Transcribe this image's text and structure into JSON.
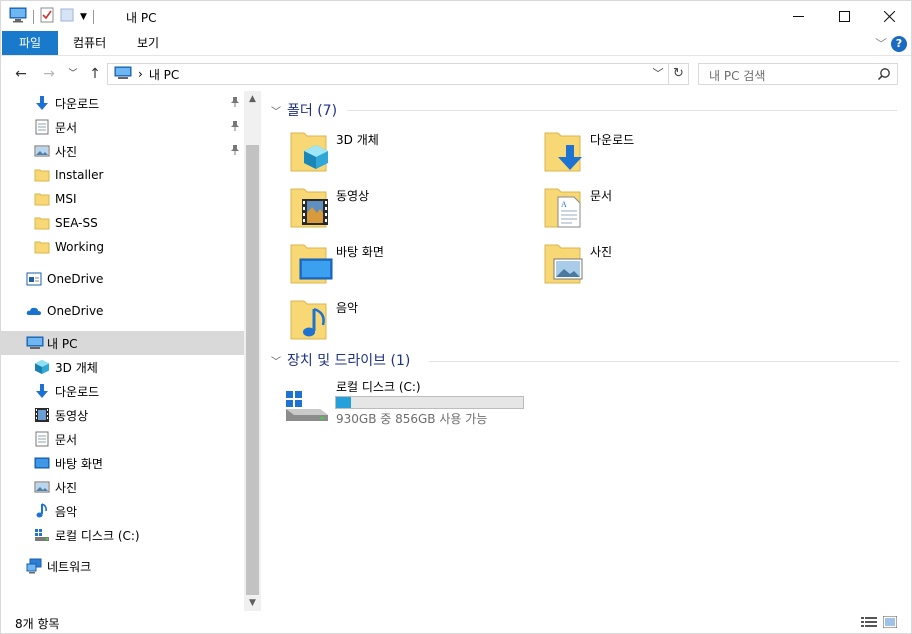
{
  "window": {
    "title": "내 PC"
  },
  "ribbon": {
    "tabs": [
      "파일",
      "컴퓨터",
      "보기"
    ],
    "help_label": "?"
  },
  "address": {
    "path": "내 PC",
    "separator": "›"
  },
  "search": {
    "placeholder": "내 PC 검색"
  },
  "nav": {
    "quick_access": [
      {
        "label": "다운로드",
        "icon": "download-icon",
        "pinned": true
      },
      {
        "label": "문서",
        "icon": "document-icon",
        "pinned": true
      },
      {
        "label": "사진",
        "icon": "pictures-icon",
        "pinned": true
      },
      {
        "label": "Installer",
        "icon": "folder-icon"
      },
      {
        "label": "MSI",
        "icon": "folder-icon"
      },
      {
        "label": "SEA-SS",
        "icon": "folder-icon"
      },
      {
        "label": "Working",
        "icon": "folder-icon"
      }
    ],
    "onedrive_1": "OneDrive",
    "onedrive_2": "OneDrive",
    "this_pc": "내 PC",
    "pc_children": [
      {
        "label": "3D 개체",
        "icon": "3d-objects-icon"
      },
      {
        "label": "다운로드",
        "icon": "download-icon"
      },
      {
        "label": "동영상",
        "icon": "videos-icon"
      },
      {
        "label": "문서",
        "icon": "document-icon"
      },
      {
        "label": "바탕 화면",
        "icon": "desktop-icon"
      },
      {
        "label": "사진",
        "icon": "pictures-icon"
      },
      {
        "label": "음악",
        "icon": "music-icon"
      },
      {
        "label": "로컬 디스크 (C:)",
        "icon": "drive-icon"
      }
    ],
    "network": "네트워크"
  },
  "content": {
    "folders_header": "폴더 (7)",
    "folders": [
      {
        "label": "3D 개체",
        "icon": "3d-objects-icon"
      },
      {
        "label": "다운로드",
        "icon": "download-icon"
      },
      {
        "label": "동영상",
        "icon": "videos-icon"
      },
      {
        "label": "문서",
        "icon": "document-icon"
      },
      {
        "label": "바탕 화면",
        "icon": "desktop-icon"
      },
      {
        "label": "사진",
        "icon": "pictures-icon"
      },
      {
        "label": "음악",
        "icon": "music-icon"
      }
    ],
    "drives_header": "장치 및 드라이브 (1)",
    "drive": {
      "label": "로컬 디스크 (C:)",
      "free_text": "930GB 중 856GB 사용 가능",
      "used_fraction": 0.08
    }
  },
  "status": {
    "count": "8개 항목"
  },
  "colors": {
    "accent": "#1979ca",
    "folder": "#f8d775",
    "header": "#1e3287",
    "selection": "#d9d9d9"
  }
}
